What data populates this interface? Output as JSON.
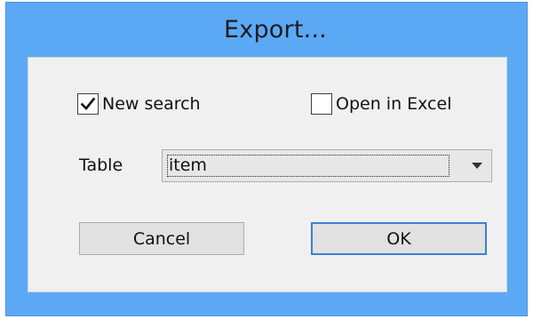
{
  "dialog": {
    "title": "Export..."
  },
  "options": {
    "new_search": {
      "label": "New search",
      "checked": true
    },
    "open_in_excel": {
      "label": "Open in Excel",
      "checked": false
    }
  },
  "table": {
    "label": "Table",
    "selected": "item"
  },
  "buttons": {
    "cancel_label": "Cancel",
    "ok_label": "OK"
  },
  "colors": {
    "titlebar": "#5ba9f5",
    "client": "#f0f0f0",
    "default_button_border": "#3c7fd6"
  },
  "icons": {
    "checkmark": "checkmark-icon",
    "dropdown": "chevron-down-icon"
  }
}
